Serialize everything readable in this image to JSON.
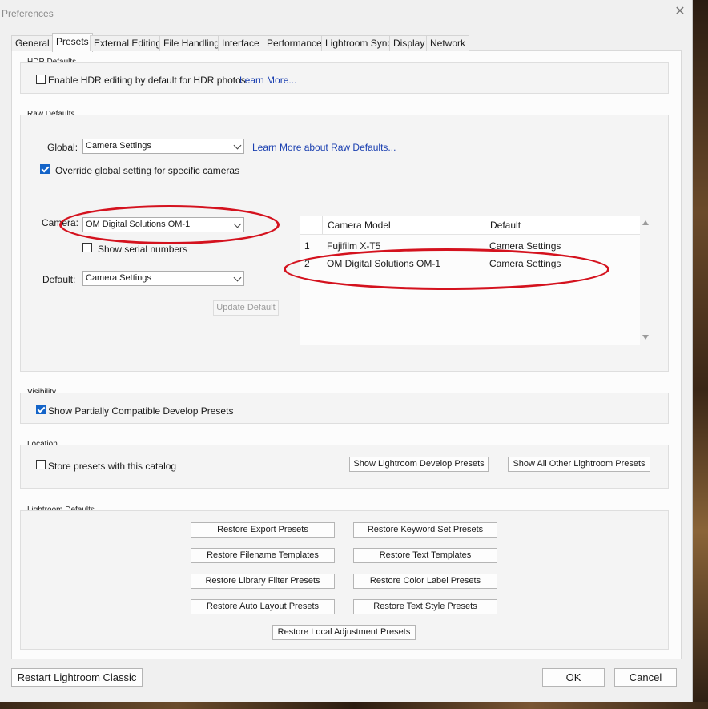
{
  "window": {
    "title": "Preferences"
  },
  "tabs": [
    "General",
    "Presets",
    "External Editing",
    "File Handling",
    "Interface",
    "Performance",
    "Lightroom Sync",
    "Display",
    "Network"
  ],
  "active_tab": "Presets",
  "hdr": {
    "group_label": "HDR Defaults",
    "checkbox_label": "Enable HDR editing by default for HDR photos",
    "checked": false,
    "learn_more": "Learn More..."
  },
  "raw": {
    "group_label": "Raw Defaults",
    "global_label": "Global:",
    "global_value": "Camera Settings",
    "learn_more": "Learn More about Raw Defaults...",
    "override_label": "Override global setting for specific cameras",
    "override_checked": true,
    "camera_label": "Camera:",
    "camera_value": "OM Digital Solutions OM-1",
    "serial_label": "Show serial numbers",
    "serial_checked": false,
    "default_label": "Default:",
    "default_value": "Camera Settings",
    "update_button": "Update Default",
    "table": {
      "columns": [
        "Camera Model",
        "Default"
      ],
      "rows": [
        {
          "num": "1",
          "model": "Fujifilm X-T5",
          "default": "Camera Settings"
        },
        {
          "num": "2",
          "model": "OM Digital Solutions OM-1",
          "default": "Camera Settings"
        }
      ]
    }
  },
  "visibility": {
    "group_label": "Visibility",
    "checkbox_label": "Show Partially Compatible Develop Presets",
    "checked": true
  },
  "location": {
    "group_label": "Location",
    "checkbox_label": "Store presets with this catalog",
    "checked": false,
    "btn_develop": "Show Lightroom Develop Presets",
    "btn_other": "Show All Other Lightroom Presets"
  },
  "lr_defaults": {
    "group_label": "Lightroom Defaults",
    "buttons": [
      "Restore Export Presets",
      "Restore Keyword Set Presets",
      "Restore Filename Templates",
      "Restore Text Templates",
      "Restore Library Filter Presets",
      "Restore Color Label Presets",
      "Restore Auto Layout Presets",
      "Restore Text Style Presets",
      "Restore Local Adjustment Presets"
    ]
  },
  "footer": {
    "restart": "Restart Lightroom Classic",
    "ok": "OK",
    "cancel": "Cancel"
  },
  "colors": {
    "accent": "#1464c8",
    "annotation": "#d4121e",
    "link": "#1a3fb0"
  }
}
